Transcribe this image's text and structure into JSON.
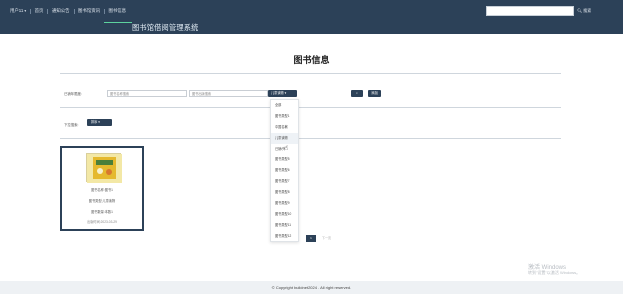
{
  "nav": {
    "user": "用户11",
    "items": [
      "首页",
      "通知公告",
      "图书馆资讯",
      "图书信息"
    ],
    "active_index": 3,
    "search_button": "搜索"
  },
  "system_title": "图书馆借阅管理系统",
  "page_title": "图书信息",
  "filter": {
    "label": "已销年限度:",
    "input1_placeholder": "图书名称搜索",
    "input2_placeholder": "图书出版搜索",
    "select_value": "儿童读物",
    "search_icon": "search-icon",
    "reset_label": "添加"
  },
  "dropdown": {
    "items": [
      "全部",
      "图书类型1",
      "中国名著",
      "儿童读物",
      "已销/外",
      "图书类型5",
      "图书类型6",
      "图书类型7",
      "图书类型8",
      "图书类型9",
      "图书类型10",
      "图书类型11",
      "图书类型12"
    ],
    "hover_index": 3
  },
  "sort": {
    "label": "下拉搜索:",
    "button": "排序"
  },
  "book": {
    "name": "图书名称:图书1",
    "type": "图书类型:儿童读物",
    "count": "图书数量:本数1",
    "date": "出版时间:2023-03-29",
    "cover_icon": "book-cover-image"
  },
  "pager": {
    "current": "1",
    "next": "下一页"
  },
  "footer": "© Copyright buildnet2024 . All right reserved.",
  "watermark": {
    "line1": "激活 Windows",
    "line2": "转到\"设置\"以激活 Windows。"
  },
  "colors": {
    "primary": "#2c4158",
    "accent": "#5dd39e"
  }
}
